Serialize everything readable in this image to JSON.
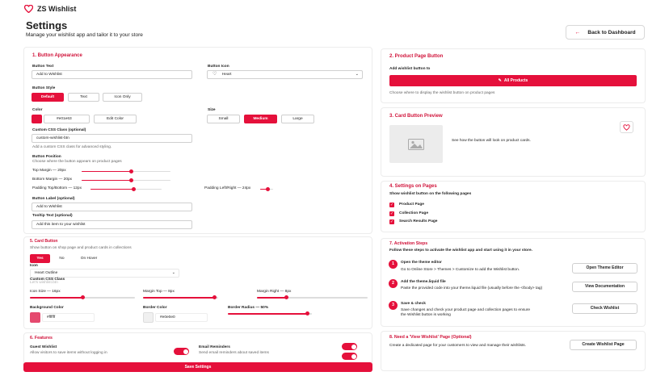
{
  "app": {
    "name": "ZS Wishlist"
  },
  "header": {
    "title": "Settings",
    "subtitle": "Manage your wishlist app and tailor it to your store",
    "back_label": "Back to Dashboard"
  },
  "button_appearance": {
    "title": "1. Button Appearance",
    "button_text_label": "Button Text",
    "button_text_value": "Add to Wishlist",
    "button_icon_label": "Button Icon",
    "button_icon_value": "Heart",
    "button_style_label": "Button Style",
    "styles": [
      "Default",
      "Text",
      "Icon Only"
    ],
    "color_label": "Color",
    "color_value": "#e01e63",
    "color_swatch": "#e5103b",
    "edit_color_label": "Edit Color",
    "size_label": "Size",
    "sizes": [
      "Small",
      "Medium",
      "Large"
    ],
    "css_label": "Custom CSS Class (optional)",
    "css_value": "custom-wishlist-btn",
    "css_help": "Add a custom CSS class for advanced styling.",
    "position_label": "Button Position",
    "position_help": "Choose where the button appears on product pages",
    "top_margin": "Top Margin — 20px",
    "bottom_margin": "Bottom Margin — 20px",
    "padding_tb": "Padding Top/Bottom — 12px",
    "padding_lr": "Padding Left/Right — 24px",
    "label_optional": "Button Label (optional)",
    "label_value": "Add to Wishlist",
    "tooltip_label": "Tooltip Text (optional)",
    "tooltip_value": "Add this item to your wishlist"
  },
  "sliders": {
    "top_margin": 0.56,
    "bottom_margin": 0.56,
    "padding_tb": 0.61,
    "padding_lr": 0.61
  },
  "card_button": {
    "title": "5. Card Button",
    "help": "Show button on shop page and product cards in collections",
    "options": [
      "Yes",
      "No",
      "On Hover"
    ],
    "icon_label": "Icon",
    "icon_value": "Heart Outline",
    "css_overlap_a": "Custom CSS Class",
    "css_overlap_b": "Let's wishlist.btn",
    "icon_size": "Icon Size — 16px",
    "margin_top": "Margin Top — 8px",
    "margin_right": "Margin Right — 8px",
    "bg_label": "Background Color",
    "bg_value": "#ffffff",
    "bg_swatch": "#e54a6f",
    "border_label": "Border Color",
    "border_value": "#e0e0e0",
    "border_swatch": "#e0e0e0",
    "radius_label": "Border Radius — 50%"
  },
  "card_sliders": {
    "icon_size": 0.5,
    "margin_top": 0.95,
    "margin_right": 0.27,
    "radius": 0.95
  },
  "features": {
    "title": "6. Features",
    "guest_title": "Guest Wishlist",
    "guest_desc": "Allow visitors to save items without logging in",
    "email_title": "Email Reminders",
    "email_desc": "Send email reminders about saved items"
  },
  "save_label": "Save Settings",
  "product_page": {
    "title": "2. Product Page Button",
    "add_label": "Add wishlist button to",
    "all_products": "All Products",
    "help": "Choose where to display the wishlist button on product pages"
  },
  "preview": {
    "title": "3. Card Button Preview",
    "text": "See how the button will look on product cards."
  },
  "pages": {
    "title": "4. Settings on Pages",
    "help": "Show wishlist button on the following pages",
    "items": [
      "Product Page",
      "Collection Page",
      "Search Results Page"
    ]
  },
  "activation": {
    "title": "7. Activation Steps",
    "help": "Follow these steps to activate the wishlist app and start using it in your store.",
    "steps": [
      {
        "n": "1",
        "title": "Open the theme editor",
        "desc": "Go to Online Store > Themes > Customize to add the Wishlist button.",
        "desc2": "",
        "btn": "Open Theme Editor"
      },
      {
        "n": "2",
        "title": "Add the theme.liquid file",
        "desc": "Paste the provided code into your theme.liquid file (usually before the </body> tag)",
        "desc2": "",
        "btn": "View Documentation"
      },
      {
        "n": "3",
        "title": "Save & check",
        "desc": "Save changes and check your product page and collection pages to ensure",
        "desc2": "the Wishlist button is working",
        "btn": "Check Wishlist"
      }
    ]
  },
  "wishlist_page": {
    "title": "8. Need a 'View Wishlist' Page (Optional)",
    "help": "Create a dedicated page for your customers to view and manage their wishlists.",
    "btn": "Create Wishlist Page"
  },
  "colors": {
    "accent": "#e5103b"
  }
}
